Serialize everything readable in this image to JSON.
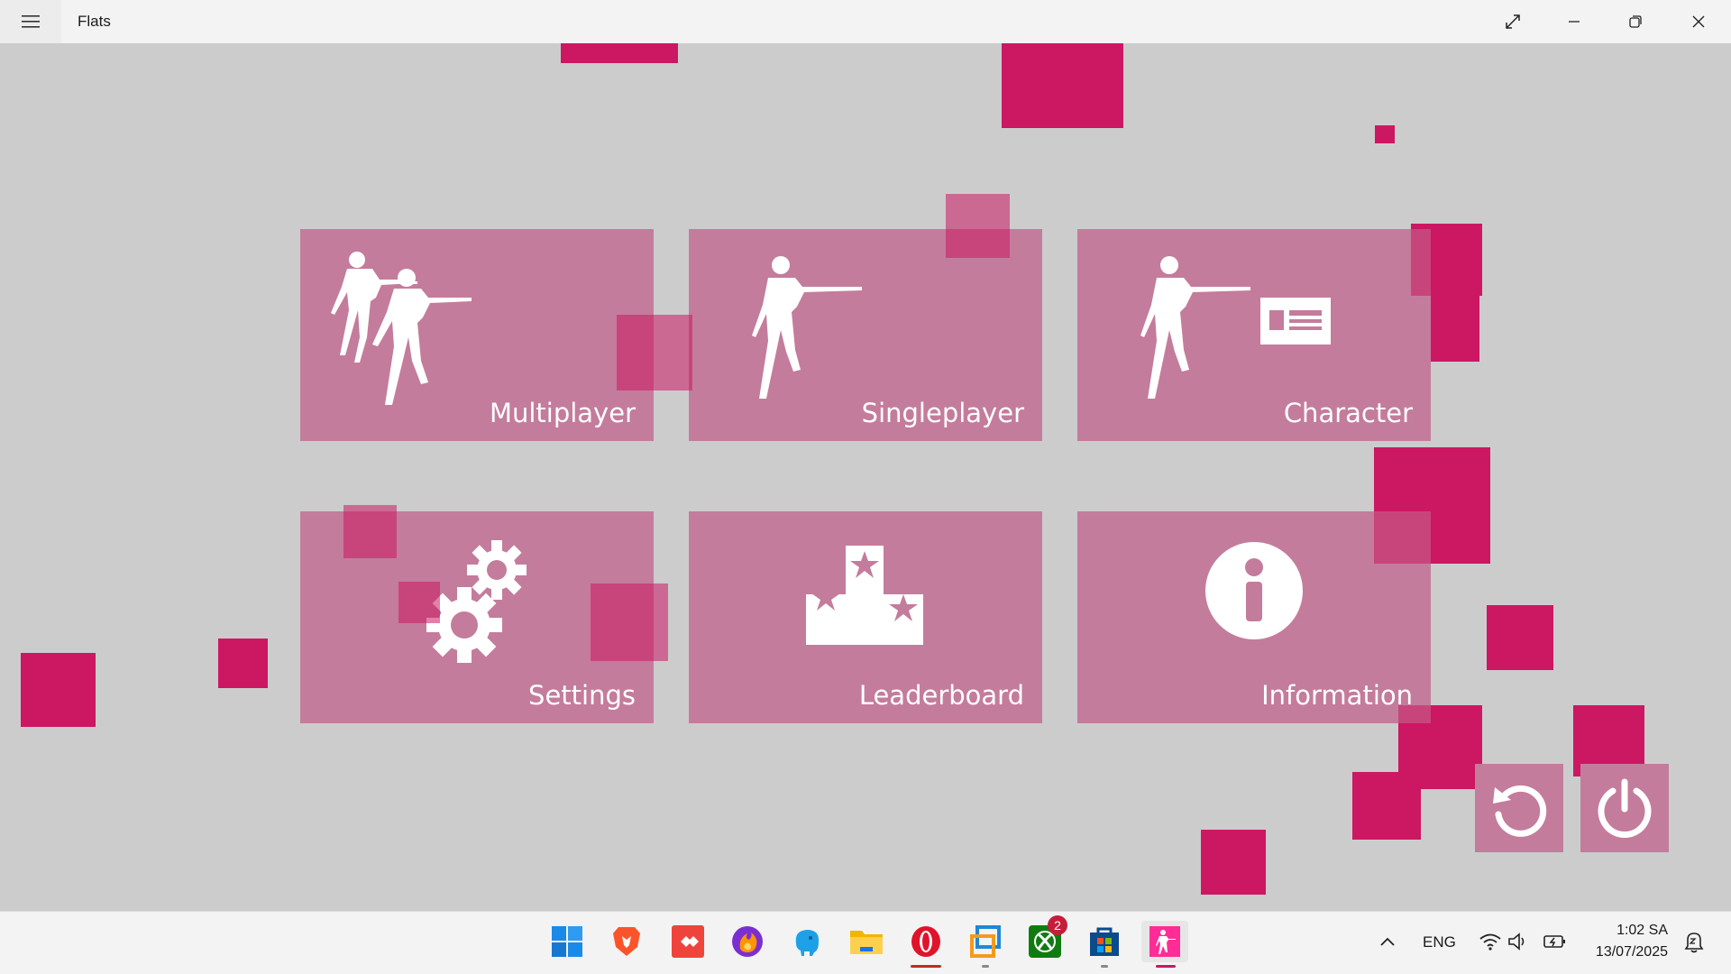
{
  "window": {
    "title": "Flats"
  },
  "tiles": [
    {
      "label": "Multiplayer",
      "icon": "soldiers-icon"
    },
    {
      "label": "Singleplayer",
      "icon": "soldier-icon"
    },
    {
      "label": "Character",
      "icon": "soldier-id-card-icon"
    },
    {
      "label": "Settings",
      "icon": "gears-icon"
    },
    {
      "label": "Leaderboard",
      "icon": "podium-icon"
    },
    {
      "label": "Information",
      "icon": "info-icon"
    }
  ],
  "actions": {
    "restart_icon": "restart-icon",
    "power_icon": "power-icon"
  },
  "taskbar": {
    "apps": [
      "start",
      "brave",
      "anydesk",
      "firefox",
      "tableplus",
      "file-explorer",
      "opera",
      "virtualbox",
      "xbox",
      "microsoft-store",
      "flats"
    ],
    "xbox_badge": "2",
    "language": "ENG",
    "time": "1:02 SA",
    "date": "13/07/2025"
  },
  "colors": {
    "accent": "#cc1763",
    "tile": "#c47c9c",
    "background": "#cccccc"
  }
}
